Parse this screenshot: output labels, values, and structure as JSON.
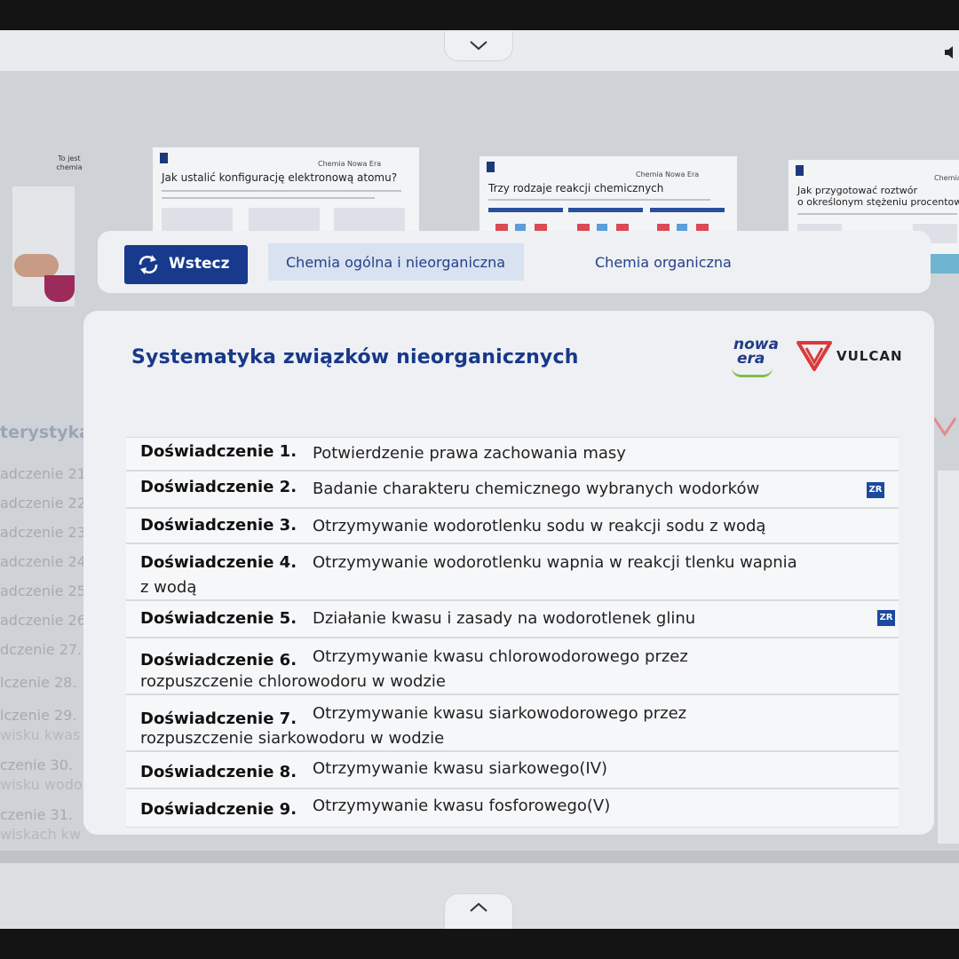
{
  "background_thumbnails": [
    {
      "title": "Jak ustalić konfigurację elektronową atomu?",
      "brand": "Chemia Nowa Era"
    },
    {
      "title": "Trzy rodzaje reakcji chemicznych",
      "brand": "Chemia Nowa Era"
    },
    {
      "title_line1": "Jak przygotować roztwór",
      "title_line2": "o określonym stężeniu procentowym i",
      "brand": "Chemia"
    }
  ],
  "photo_caption": "To jest chemia",
  "left_list": {
    "heading": "terystyka p",
    "items": [
      "adczenie 21.",
      "adczenie 22.",
      "adczenie 23.",
      "adczenie 24.",
      "adczenie 25.",
      "adczenie 26.",
      "dczenie 27.",
      "lczenie 28.",
      "lczenie 29.",
      "czenie 30.",
      "czenie 31."
    ],
    "subs": [
      "wisku kwas",
      "wisku wodo",
      "wiskach kw"
    ]
  },
  "nav": {
    "back_label": "Wstecz",
    "tabs": [
      "Chemia ogólna i nieorganiczna",
      "Chemia organiczna"
    ]
  },
  "card": {
    "title": "Systematyka związków nieorganicznych",
    "logo_nowa_era": {
      "line1": "nowa",
      "line2": "era"
    },
    "logo_vulcan": "VULCAN",
    "experiments": [
      {
        "num": "Doświadczenie 1.",
        "line1": "Potwierdzenie prawa zachowania masy",
        "line2": "",
        "badge": ""
      },
      {
        "num": "Doświadczenie 2.",
        "line1": "Badanie charakteru chemicznego wybranych wodorków",
        "line2": "",
        "badge": "ZR"
      },
      {
        "num": "Doświadczenie 3.",
        "line1": "Otrzymywanie wodorotlenku sodu w reakcji sodu z wodą",
        "line2": "",
        "badge": ""
      },
      {
        "num": "Doświadczenie 4.",
        "line1": "Otrzymywanie wodorotlenku wapnia w reakcji tlenku wapnia",
        "line2": "z wodą",
        "badge": ""
      },
      {
        "num": "Doświadczenie 5.",
        "line1": "Działanie kwasu i zasady na wodorotlenek glinu",
        "line2": "",
        "badge": "ZR"
      },
      {
        "num": "Doświadczenie 6.",
        "line1": "Otrzymywanie kwasu chlorowodorowego przez",
        "line2": "rozpuszczenie chlorowodoru w wodzie",
        "badge": ""
      },
      {
        "num": "Doświadczenie 7.",
        "line1": "Otrzymywanie kwasu siarkowodorowego przez",
        "line2": "rozpuszczenie siarkowodoru w wodzie",
        "badge": ""
      },
      {
        "num": "Doświadczenie 8.",
        "line1": "Otrzymywanie kwasu siarkowego(IV)",
        "line2": "",
        "badge": ""
      },
      {
        "num": "Doświadczenie 9.",
        "line1": "Otrzymywanie kwasu fosforowego(V)",
        "line2": "",
        "badge": ""
      }
    ]
  },
  "colors": {
    "accent": "#173a8c",
    "title": "#18388a",
    "badge": "#1b4aa0",
    "vulcan_red": "#d93a3a",
    "nowa_green": "#7cc043"
  }
}
